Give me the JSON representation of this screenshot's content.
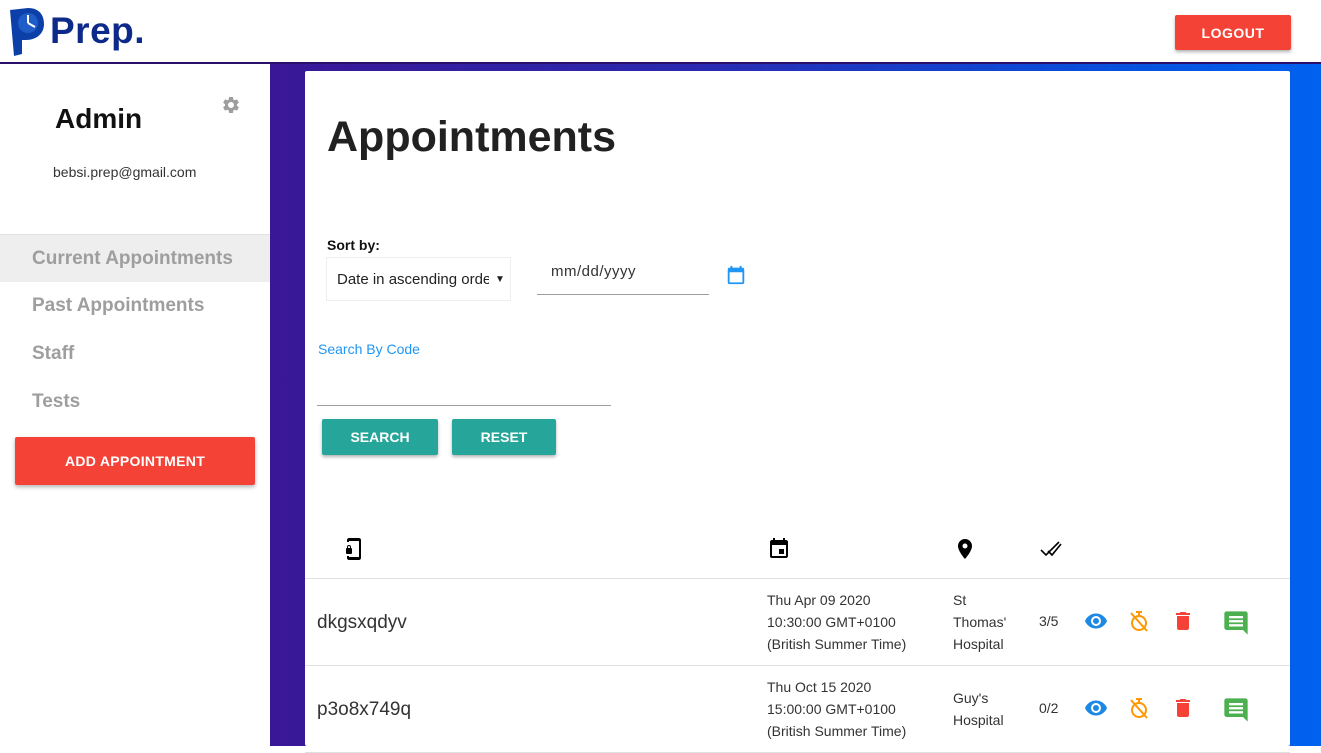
{
  "header": {
    "brand": "Prep.",
    "logout_label": "LOGOUT"
  },
  "sidebar": {
    "user_name": "Admin",
    "user_email": "bebsi.prep@gmail.com",
    "items": [
      {
        "label": "Current Appointments",
        "active": true
      },
      {
        "label": "Past Appointments",
        "active": false
      },
      {
        "label": "Staff",
        "active": false
      },
      {
        "label": "Tests",
        "active": false
      }
    ],
    "add_button_label": "ADD APPOINTMENT"
  },
  "main": {
    "title": "Appointments",
    "sort": {
      "label": "Sort by:",
      "selected": "Date in ascending order"
    },
    "date_filter": {
      "placeholder": "mm/dd/yyyy"
    },
    "search": {
      "label": "Search By Code",
      "value": "",
      "search_button": "SEARCH",
      "reset_button": "RESET"
    },
    "table": {
      "columns": [
        "device-lock-icon",
        "calendar-icon",
        "location-icon",
        "done-all-icon"
      ],
      "rows": [
        {
          "code": "dkgsxqdyv",
          "date_line1": "Thu Apr 09 2020",
          "date_line2": "10:30:00 GMT+0100",
          "date_line3": "(British Summer Time)",
          "location": "St Thomas' Hospital",
          "score": "3/5"
        },
        {
          "code": "p3o8x749q",
          "date_line1": "Thu Oct 15 2020",
          "date_line2": "15:00:00 GMT+0100",
          "date_line3": "(British Summer Time)",
          "location": "Guy's Hospital",
          "score": "0/2"
        }
      ]
    }
  },
  "colors": {
    "primary_red": "#f44336",
    "teal": "#26a69a",
    "link_blue": "#2196f3",
    "eye_blue": "#1e88e5",
    "timer_orange": "#ff9800",
    "delete_red": "#f44336",
    "comment_green": "#4caf50",
    "brand_navy": "#0d2a8a"
  }
}
